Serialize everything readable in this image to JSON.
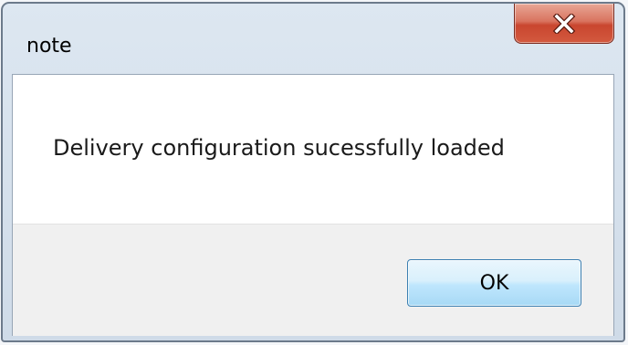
{
  "window": {
    "title": "note"
  },
  "titlebar": {
    "close_icon": "close-icon"
  },
  "dialog": {
    "message": "Delivery configuration sucessfully loaded",
    "ok_label": "OK"
  },
  "colors": {
    "close_button_red": "#c9462f",
    "ok_button_border": "#3c7fb1",
    "footer_background": "#f0f0f0",
    "frame_background": "#cfdbe8"
  }
}
